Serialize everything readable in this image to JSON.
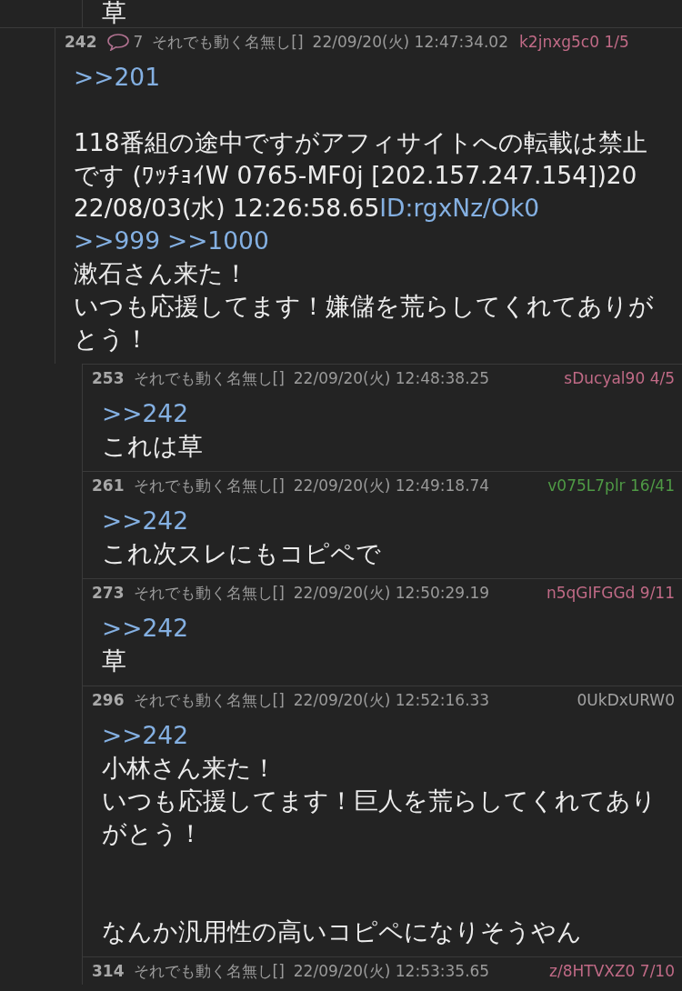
{
  "top_fragment": {
    "body": [
      {
        "kind": "text",
        "segments": [
          {
            "kind": "text",
            "text": "草"
          }
        ]
      }
    ]
  },
  "posts": [
    {
      "number": "242",
      "reply_count": "7",
      "name": "それでも動く名無し[]",
      "date": "22/09/20(火) 12:47:34.02",
      "id": "k2jnxg5c0 1/5",
      "color": "#c06a86",
      "body": [
        {
          "kind": "text",
          "segments": [
            {
              "kind": "link",
              "text": ">>201"
            }
          ]
        },
        {
          "kind": "break"
        },
        {
          "kind": "text",
          "segments": [
            {
              "kind": "text",
              "text": "118番組の途中ですがアフィサイトへの転載は禁止"
            }
          ]
        },
        {
          "kind": "text",
          "segments": [
            {
              "kind": "text",
              "text": "です (ﾜｯﾁｮｲW 0765-MF0j [202.157.247.154])20"
            }
          ]
        },
        {
          "kind": "text",
          "segments": [
            {
              "kind": "text",
              "text": "22/08/03(水) 12:26:58.65"
            },
            {
              "kind": "link",
              "text": "ID:rgxNz/Ok0"
            }
          ]
        },
        {
          "kind": "text",
          "segments": [
            {
              "kind": "link",
              "text": ">>999"
            },
            {
              "kind": "link",
              "text": ">>1000"
            }
          ]
        },
        {
          "kind": "text",
          "segments": [
            {
              "kind": "text",
              "text": "漱石さん来た！"
            }
          ]
        },
        {
          "kind": "text",
          "segments": [
            {
              "kind": "text",
              "text": "いつも応援してます！嫌儲を荒らしてくれてありがとう！"
            }
          ]
        }
      ],
      "replies": [
        {
          "number": "253",
          "name": "それでも動く名無し[]",
          "date": "22/09/20(火) 12:48:38.25",
          "id": "sDucyal90 4/5",
          "color": "#c06a86",
          "body": [
            {
              "kind": "text",
              "segments": [
                {
                  "kind": "link",
                  "text": ">>242"
                }
              ]
            },
            {
              "kind": "text",
              "segments": [
                {
                  "kind": "text",
                  "text": "これは草"
                }
              ]
            }
          ]
        },
        {
          "number": "261",
          "name": "それでも動く名無し[]",
          "date": "22/09/20(火) 12:49:18.74",
          "id": "v075L7plr 16/41",
          "color": "#4f9a45",
          "body": [
            {
              "kind": "text",
              "segments": [
                {
                  "kind": "link",
                  "text": ">>242"
                }
              ]
            },
            {
              "kind": "text",
              "segments": [
                {
                  "kind": "text",
                  "text": "これ次スレにもコピペで"
                }
              ]
            }
          ]
        },
        {
          "number": "273",
          "name": "それでも動く名無し[]",
          "date": "22/09/20(火) 12:50:29.19",
          "id": "n5qGIFGGd 9/11",
          "color": "#c06a86",
          "body": [
            {
              "kind": "text",
              "segments": [
                {
                  "kind": "link",
                  "text": ">>242"
                }
              ]
            },
            {
              "kind": "text",
              "segments": [
                {
                  "kind": "text",
                  "text": "草"
                }
              ]
            }
          ]
        },
        {
          "number": "296",
          "name": "それでも動く名無し[]",
          "date": "22/09/20(火) 12:52:16.33",
          "id": "0UkDxURW0",
          "color": "#a3a3a3",
          "body": [
            {
              "kind": "text",
              "segments": [
                {
                  "kind": "link",
                  "text": ">>242"
                }
              ]
            },
            {
              "kind": "text",
              "segments": [
                {
                  "kind": "text",
                  "text": "小林さん来た！"
                }
              ]
            },
            {
              "kind": "text",
              "segments": [
                {
                  "kind": "text",
                  "text": "いつも応援してます！巨人を荒らしてくれてありがとう！"
                }
              ]
            },
            {
              "kind": "break"
            },
            {
              "kind": "break"
            },
            {
              "kind": "text",
              "segments": [
                {
                  "kind": "text",
                  "text": "なんか汎用性の高いコピペになりそうやん"
                }
              ]
            }
          ]
        },
        {
          "number": "314",
          "name": "それでも動く名無し[]",
          "date": "22/09/20(火) 12:53:35.65",
          "id": "z/8HTVXZ0 7/10",
          "color": "#c06a86"
        }
      ]
    }
  ]
}
